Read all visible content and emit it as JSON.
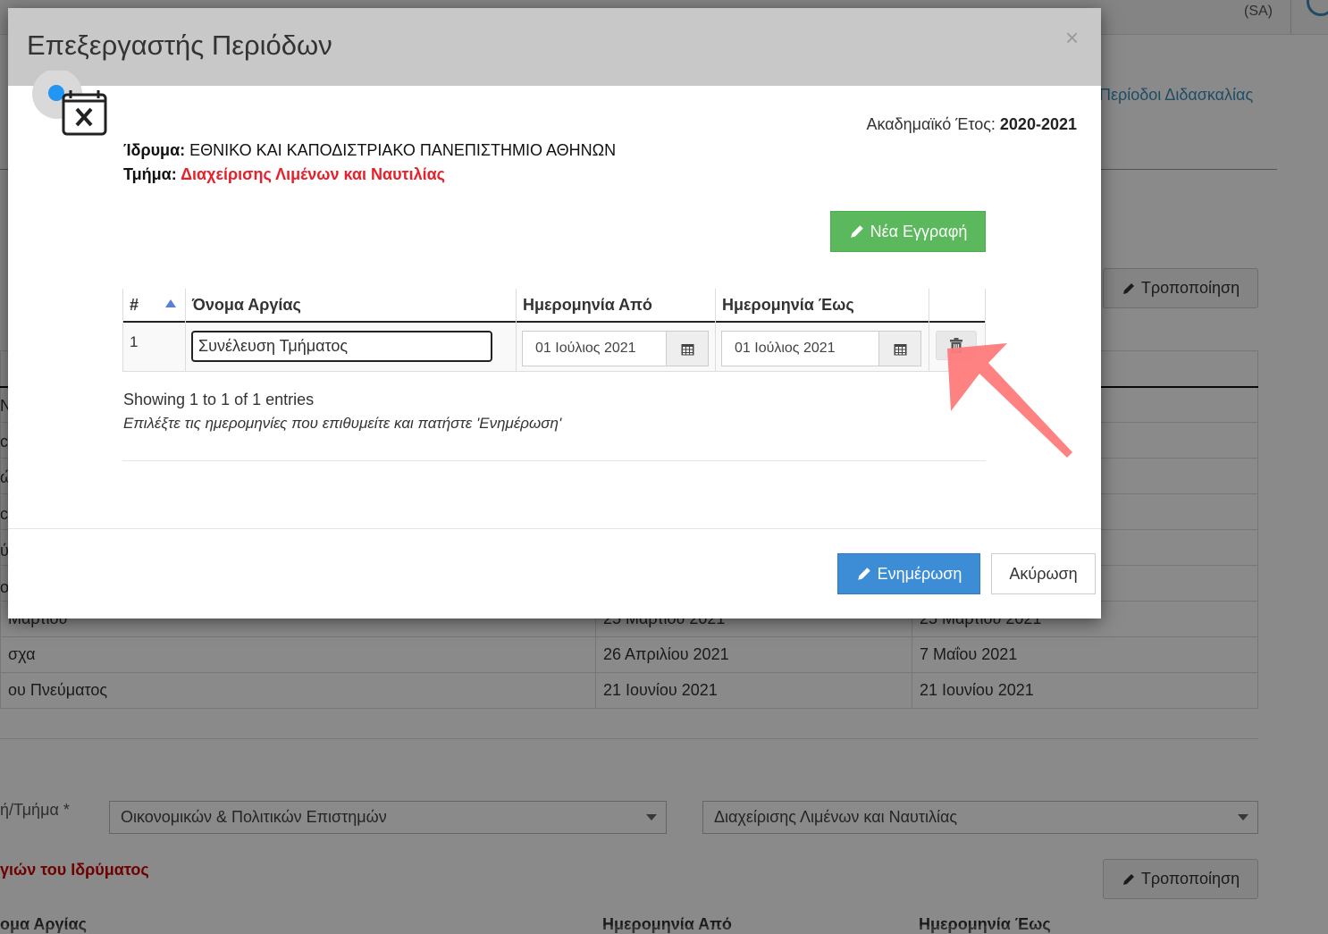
{
  "background": {
    "top_bar": {
      "sa_label": "(SA)"
    },
    "breadcrumb": "Περίοδοι Διδασκαλίας",
    "edit_button_label": "Τροποποίηση",
    "left_fragments": [
      "N",
      "c",
      "ώ",
      "c",
      "ύ",
      "ο",
      "Μαρτίου",
      "σχα",
      "ου Πνεύματος"
    ],
    "table_rows": [
      {
        "name": "Μαρτίου",
        "from": "25 Μαρτίου 2021",
        "to": "25 Μαρτίου 2021"
      },
      {
        "name": "σχα",
        "from": "26 Απριλίου 2021",
        "to": "7 Μαΐου 2021"
      },
      {
        "name": "ου Πνεύματος",
        "from": "21 Ιουνίου 2021",
        "to": "21 Ιουνίου 2021"
      }
    ],
    "faculty_label": "ή/Τμήμα *",
    "faculty_select": "Οικονομικών & Πολιτικών Επιστημών",
    "department_select": "Διαχείρισης Λιμένων και Ναυτιλίας",
    "holidays_heading": "γιών του Ιδρύματος",
    "bottom_headers": [
      "ομα Αργίας",
      "Ημερομηνία Από",
      "Ημερομηνία Έως"
    ]
  },
  "modal": {
    "title": "Επεξεργαστής Περιόδων",
    "close_symbol": "×",
    "academic_year_label": "Ακαδημαϊκό Έτος:",
    "academic_year_value": "2020-2021",
    "institution_label": "Ίδρυμα:",
    "institution_value": "ΕΘΝΙΚΟ ΚΑΙ ΚΑΠΟΔΙΣΤΡΙΑΚΟ ΠΑΝΕΠΙΣΤΗΜΙΟ ΑΘΗΝΩΝ",
    "department_label": "Τμήμα:",
    "department_value": "Διαχείρισης Λιμένων και Ναυτιλίας",
    "new_entry_label": "Νέα Εγγραφή",
    "table": {
      "headers": [
        "#",
        "Όνομα Αργίας",
        "Ημερομηνία Από",
        "Ημερομηνία Έως"
      ],
      "rows": [
        {
          "num": "1",
          "name": "Συνέλευση Τμήματος",
          "from": "01 Ιούλιος 2021",
          "to": "01 Ιούλιος 2021"
        }
      ]
    },
    "showing_text": "Showing 1 to 1 of 1 entries",
    "hint_text": "Επιλέξτε τις ημερομηνίες που επιθυμείτε και πατήστε 'Ενημέρωση'",
    "update_label": "Ενημέρωση",
    "cancel_label": "Ακύρωση"
  },
  "colors": {
    "header_bg": "#c8c8c8",
    "success": "#5cb85c",
    "primary": "#3c8dd6",
    "danger_text": "#e8202a",
    "annotation_arrow": "#ff7b7b"
  },
  "icons": [
    "calendar-x-icon",
    "pencil-icon",
    "calendar-icon",
    "trash-icon",
    "close-icon",
    "sort-asc-icon"
  ]
}
